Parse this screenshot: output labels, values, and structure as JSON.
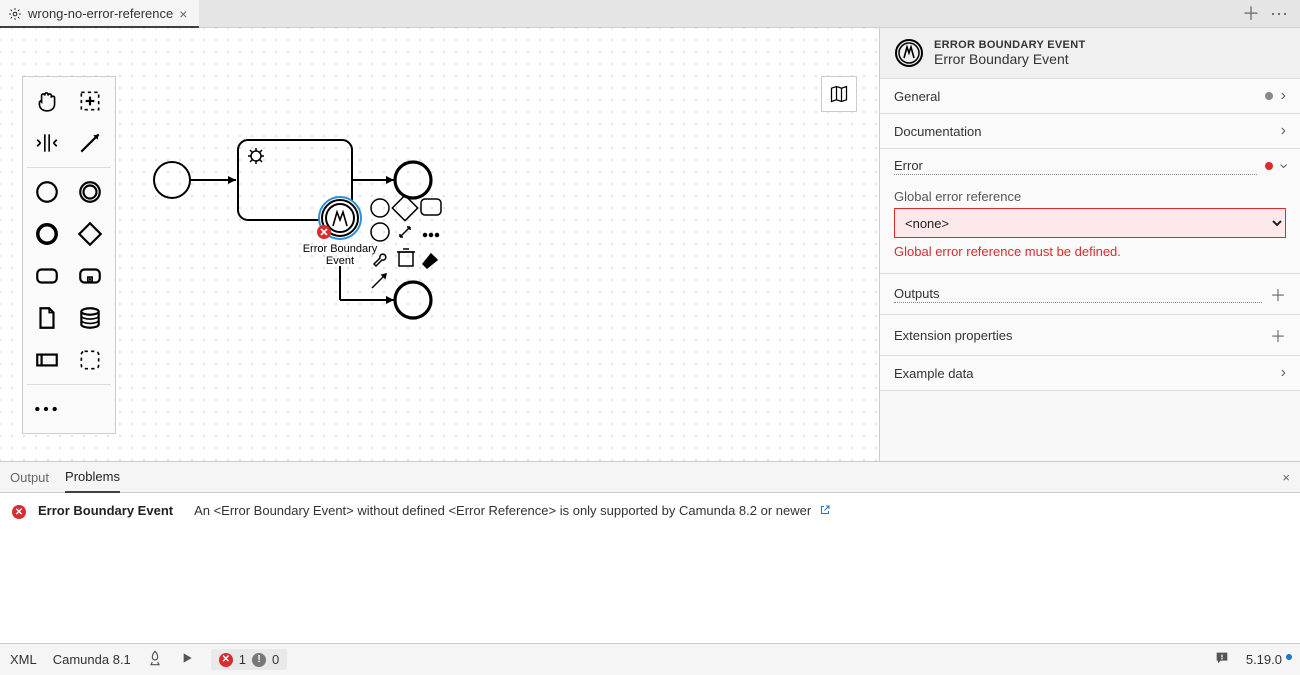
{
  "tab": {
    "title": "wrong-no-error-reference"
  },
  "palette": {
    "tools": [
      "hand",
      "lasso",
      "space",
      "arrow",
      "start-event",
      "intermediate-event",
      "end-event",
      "gateway",
      "task",
      "subprocess",
      "data-object",
      "data-store",
      "pool",
      "group",
      "more"
    ]
  },
  "diagram": {
    "boundary_event_label": "Error Boundary Event"
  },
  "panel": {
    "type_label": "ERROR BOUNDARY EVENT",
    "name": "Error Boundary Event",
    "sections": {
      "general": "General",
      "documentation": "Documentation",
      "error": "Error",
      "outputs": "Outputs",
      "extension": "Extension properties",
      "example": "Example data"
    },
    "error_field": {
      "label": "Global error reference",
      "value": "<none>",
      "validation": "Global error reference must be defined."
    }
  },
  "tabs": {
    "output": "Output",
    "problems": "Problems"
  },
  "problem": {
    "source": "Error Boundary Event",
    "message": "An <Error Boundary Event> without defined <Error Reference> is only supported by Camunda 8.2 or newer"
  },
  "status": {
    "left1": "XML",
    "left2": "Camunda 8.1",
    "errors": 1,
    "warnings": 0,
    "version": "5.19.0"
  }
}
